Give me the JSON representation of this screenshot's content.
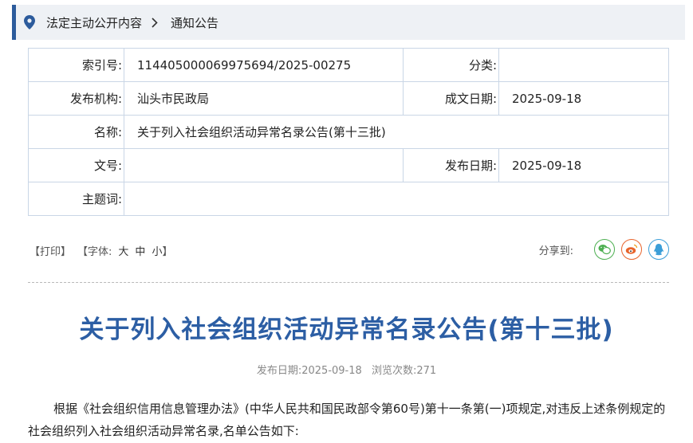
{
  "breadcrumb": {
    "items": [
      "法定主动公开内容",
      "通知公告"
    ]
  },
  "meta": {
    "index_no_label": "索引号:",
    "index_no_value": "114405000069975694/2025-00275",
    "category_label": "分类:",
    "category_value": "",
    "publisher_label": "发布机构:",
    "publisher_value": "汕头市民政局",
    "created_date_label": "成文日期:",
    "created_date_value": "2025-09-18",
    "name_label": "名称:",
    "name_value": "关于列入社会组织活动异常名录公告(第十三批)",
    "doc_no_label": "文号:",
    "doc_no_value": "",
    "publish_date_label": "发布日期:",
    "publish_date_value": "2025-09-18",
    "keywords_label": "主题词:",
    "keywords_value": ""
  },
  "tools": {
    "print": "【打印】",
    "font_prefix": "【字体:",
    "font_large": "大",
    "font_medium": "中",
    "font_small": "小",
    "font_suffix": "】"
  },
  "share": {
    "label": "分享到:",
    "icons": [
      "wechat-icon",
      "weibo-icon",
      "qq-icon"
    ],
    "colors": {
      "wechat": "#4caf50",
      "weibo": "#e8642c",
      "qq": "#3b9ed8"
    }
  },
  "article": {
    "title": "关于列入社会组织活动异常名录公告(第十三批)",
    "publish_date_label": "发布日期:",
    "publish_date_value": "2025-09-18",
    "views_label": "浏览次数:",
    "views_value": "271",
    "body": "根据《社会组织信用信息管理办法》(中华人民共和国民政部令第60号)第十一条第(一)项规定,对违反上述条例规定的社会组织列入社会组织活动异常名录,名单公告如下:"
  },
  "colors": {
    "accent": "#2c5b9c",
    "title": "#2c5ea4",
    "table_border": "#c9d6e6",
    "breadcrumb_bg": "#eef1f5"
  }
}
